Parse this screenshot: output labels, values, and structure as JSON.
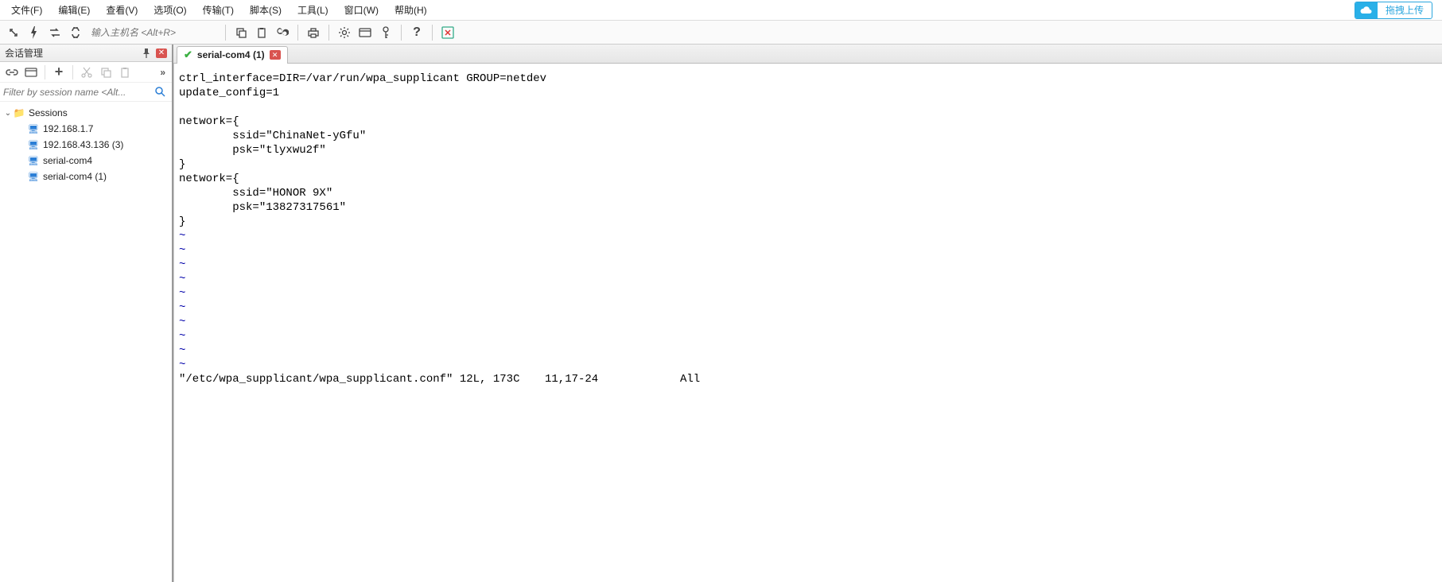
{
  "menu": {
    "file": "文件(F)",
    "edit": "编辑(E)",
    "view": "查看(V)",
    "options": "选项(O)",
    "transfer": "传输(T)",
    "script": "脚本(S)",
    "tools": "工具(L)",
    "window": "窗口(W)",
    "help": "帮助(H)"
  },
  "upload_button": {
    "label": "拖拽上传"
  },
  "toolbar": {
    "host_placeholder": "输入主机名 <Alt+R>"
  },
  "sidebar": {
    "title": "会话管理",
    "filter_placeholder": "Filter by session name <Alt...",
    "root_label": "Sessions",
    "items": [
      {
        "label": "192.168.1.7"
      },
      {
        "label": "192.168.43.136 (3)"
      },
      {
        "label": "serial-com4"
      },
      {
        "label": "serial-com4 (1)"
      }
    ]
  },
  "tab": {
    "label": "serial-com4 (1)"
  },
  "terminal": {
    "lines": [
      "ctrl_interface=DIR=/var/run/wpa_supplicant GROUP=netdev",
      "update_config=1",
      "",
      "network={",
      "        ssid=\"ChinaNet-yGfu\"",
      "        psk=\"tlyxwu2f\"",
      "}",
      "network={",
      "        ssid=\"HONOR 9X\"",
      "        psk=\"13827317561\"",
      "}"
    ],
    "tilde_count": 10,
    "status": {
      "file": "\"/etc/wpa_supplicant/wpa_supplicant.conf\" 12L, 173C",
      "cursor": "11,17-24",
      "pos": "All"
    }
  }
}
